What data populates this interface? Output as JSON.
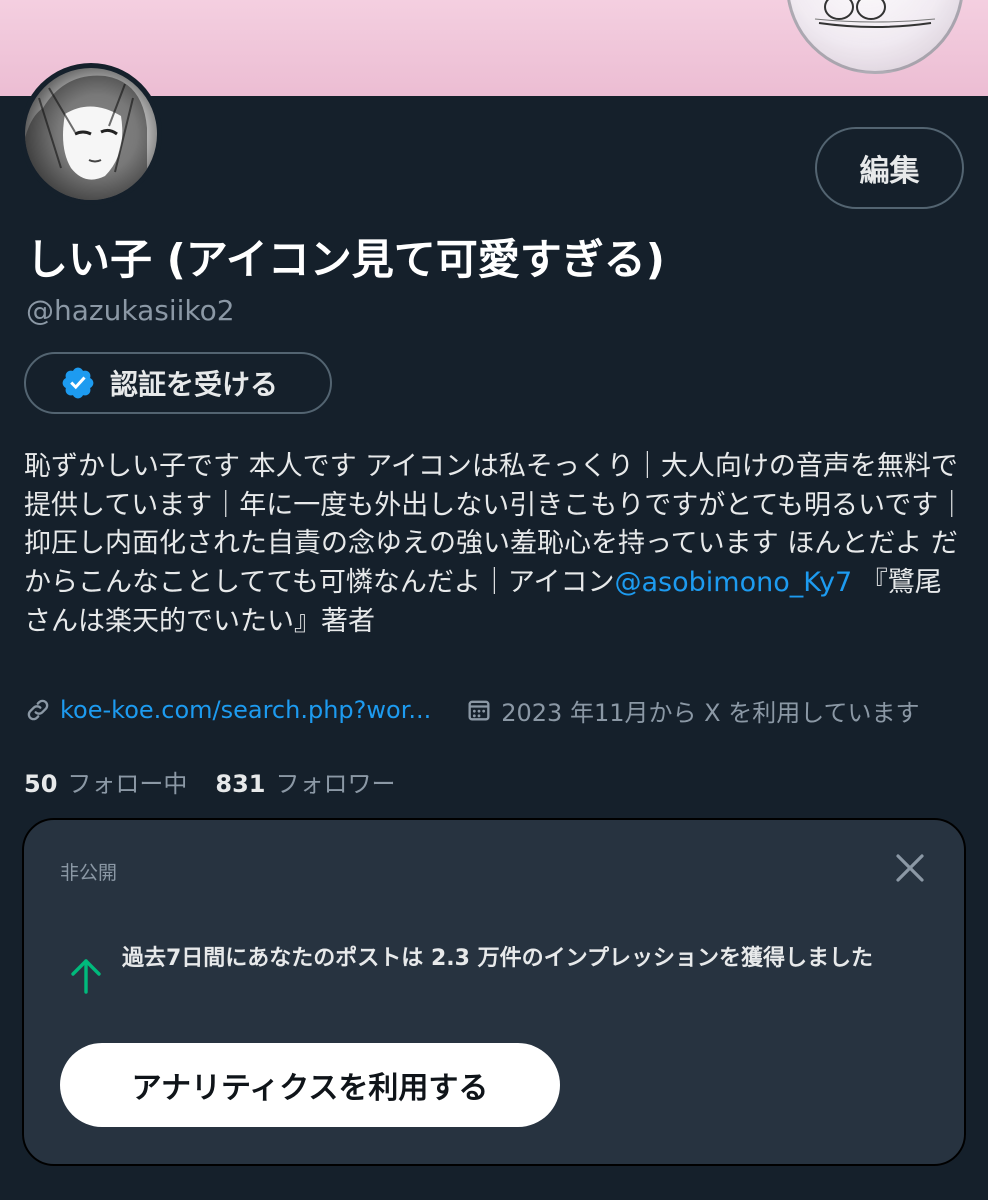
{
  "profile": {
    "display_name": "しい子 (アイコン見て可愛すぎる)",
    "handle": "@hazukasiiko2",
    "edit_label": "編集",
    "verify_label": "認証を受ける",
    "bio_text": "恥ずかしい子です 本人です アイコンは私そっくり｜大人向けの音声を無料で提供しています｜年に一度も外出しない引きこもりですがとても明るいです｜抑圧し内面化された自責の念ゆえの強い羞恥心を持っています ほんとだよ だからこんなことしてても可憐なんだよ｜アイコン",
    "bio_mention": "@asobimono_Ky7",
    "bio_suffix": " 『鷺尾さんは楽天的でいたい』著者",
    "link": "koe-koe.com/search.php?wor...",
    "joined": "2023 年11月から X を利用しています",
    "following_count": "50",
    "following_label": "フォロー中",
    "followers_count": "831",
    "followers_label": "フォロワー"
  },
  "card": {
    "private_label": "非公開",
    "message": "過去7日間にあなたのポストは 2.3 万件のインプレッションを獲得しました",
    "button_label": "アナリティクスを利用する"
  },
  "icons": {
    "verified": "verified-badge-icon",
    "link": "link-icon",
    "calendar": "calendar-icon",
    "close": "close-icon",
    "up_arrow": "arrow-up-icon"
  },
  "colors": {
    "background": "#15202b",
    "accent": "#1d9bf0",
    "banner": "#f4cfe0",
    "card": "#273340",
    "positive": "#00ba7c"
  }
}
